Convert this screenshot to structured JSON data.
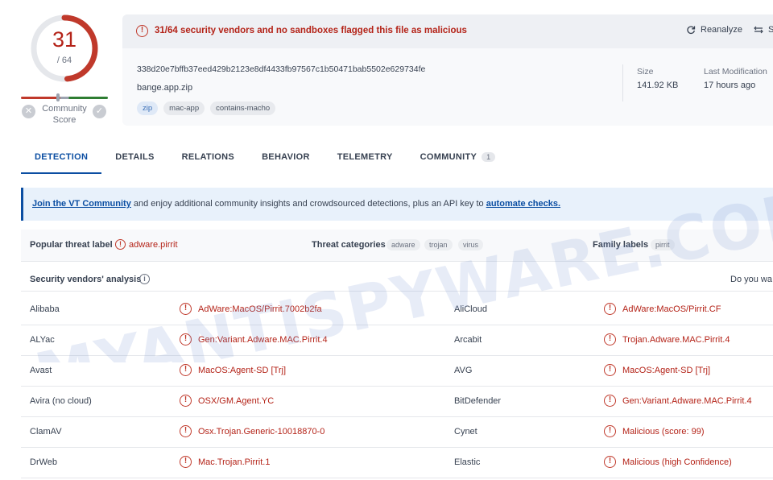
{
  "score": {
    "detections": "31",
    "total": "/ 64",
    "detections_count": 31,
    "total_count": 64,
    "community_label_line1": "Community",
    "community_label_line2": "Score"
  },
  "alert": {
    "text": "31/64 security vendors and no sandboxes flagged this file as malicious",
    "reanalyze": "Reanalyze",
    "similar": "Si"
  },
  "file": {
    "hash": "338d20e7bffb37eed429b2123e8df4433fb97567c1b50471bab5502e629734fe",
    "name": "bange.app.zip",
    "tags": [
      "zip",
      "mac-app",
      "contains-macho"
    ]
  },
  "meta": {
    "size_label": "Size",
    "size_value": "141.92 KB",
    "last_mod_label": "Last Modification",
    "last_mod_value": "17 hours ago"
  },
  "tabs": [
    {
      "label": "DETECTION"
    },
    {
      "label": "DETAILS"
    },
    {
      "label": "RELATIONS"
    },
    {
      "label": "BEHAVIOR"
    },
    {
      "label": "TELEMETRY"
    },
    {
      "label": "COMMUNITY",
      "count": "1"
    }
  ],
  "banner": {
    "link1": "Join the VT Community",
    "middle": " and enjoy additional community insights and crowdsourced detections, plus an API key to ",
    "link2": "automate checks."
  },
  "threat": {
    "popular_label": "Popular threat label",
    "popular_value": "adware.pirrit",
    "categories_label": "Threat categories",
    "categories": [
      "adware",
      "trojan",
      "virus"
    ],
    "family_label": "Family labels",
    "family": [
      "pirrit"
    ]
  },
  "vendors_header": {
    "title": "Security vendors' analysis",
    "right_text": "Do you wa"
  },
  "vendors": [
    {
      "left": "Alibaba",
      "left_det": "AdWare:MacOS/Pirrit.7002b2fa",
      "right": "AliCloud",
      "right_det": "AdWare:MacOS/Pirrit.CF"
    },
    {
      "left": "ALYac",
      "left_det": "Gen:Variant.Adware.MAC.Pirrit.4",
      "right": "Arcabit",
      "right_det": "Trojan.Adware.MAC.Pirrit.4"
    },
    {
      "left": "Avast",
      "left_det": "MacOS:Agent-SD [Trj]",
      "right": "AVG",
      "right_det": "MacOS:Agent-SD [Trj]"
    },
    {
      "left": "Avira (no cloud)",
      "left_det": "OSX/GM.Agent.YC",
      "right": "BitDefender",
      "right_det": "Gen:Variant.Adware.MAC.Pirrit.4"
    },
    {
      "left": "ClamAV",
      "left_det": "Osx.Trojan.Generic-10018870-0",
      "right": "Cynet",
      "right_det": "Malicious (score: 99)"
    },
    {
      "left": "DrWeb",
      "left_det": "Mac.Trojan.Pirrit.1",
      "right": "Elastic",
      "right_det": "Malicious (high Confidence)"
    }
  ],
  "watermark": "MYANTISPYWARE.COM",
  "colors": {
    "malicious_red": "#b42318",
    "accent_blue": "#0b4ea2"
  }
}
